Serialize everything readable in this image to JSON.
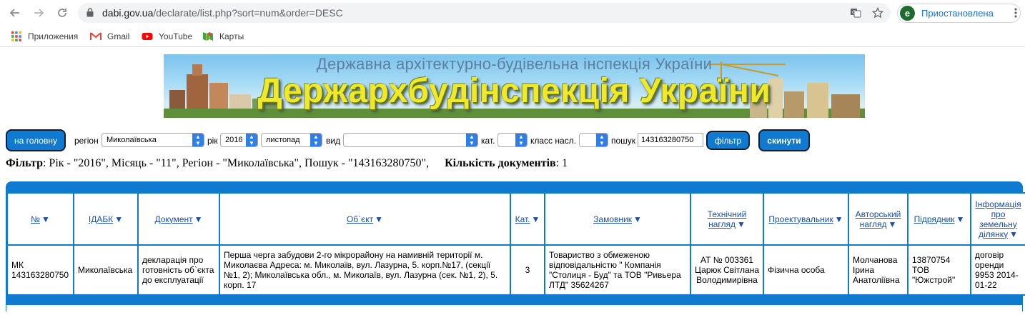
{
  "browser": {
    "url_host": "dabi.gov.ua",
    "url_path": "/declarate/list.php?sort=num&order=DESC",
    "profile_initial": "e",
    "profile_label": "Приостановлена",
    "bookmarks": [
      {
        "label": "Приложения",
        "icon": "apps-grid-icon"
      },
      {
        "label": "Gmail",
        "icon": "gmail-icon"
      },
      {
        "label": "YouTube",
        "icon": "youtube-icon"
      },
      {
        "label": "Карты",
        "icon": "maps-icon"
      }
    ]
  },
  "banner": {
    "subtitle": "Державна архітектурно-будівельна інспекція України",
    "title": "Держархбудінспекція України"
  },
  "filters": {
    "home_button": "на головну",
    "region_label": "регіон",
    "region_value": "Миколаївська",
    "year_label": "рік",
    "year_value": "2016",
    "month_value": "листопад",
    "type_label": "вид",
    "type_value": "",
    "cat_label": "кат.",
    "cat_value": "",
    "class_label": "класс насл.",
    "class_value": "",
    "search_label": "пошук",
    "search_value": "143163280750",
    "filter_button": "фільтр",
    "reset_button": "скинути"
  },
  "summary": {
    "filter_label": "Фільтр",
    "filter_text": ": Рік - \"2016\", Місяць - \"11\", Регіон - \"Миколаївська\", Пошук - \"143163280750\",",
    "count_label": "Кількість документів",
    "count_value": ": 1"
  },
  "table": {
    "headers": [
      "№",
      "ІДАБК",
      "Документ",
      "Об`єкт",
      "Кат.",
      "Замовник",
      "Технічний нагляд",
      "Проектувальник",
      "Авторський нагляд",
      "Підрядник",
      "Інформація про земельну ділянку"
    ],
    "rows": [
      [
        "МК 143163280750",
        "Миколаївська",
        "декларація про готовність об`єкта до експлуатації",
        "Перша черга забудови 2-го мікрорайону на намивній території м. Миколаєва Адреса: м. Миколаїв, вул. Лазурна, 5. корп.№17, (секції №1, 2); Миколаївська обл., м. Миколаїв, вул. Лазурна (сек. №1, 2), 5. корп. 17",
        "3",
        "Товариство з обмеженою відповідальністю \" Компанія \"Столиця - Буд\" та ТОВ \"Ривьера ЛТД\" 35624267",
        "АТ № 003361 Царюк Світлана Володимирівна",
        "Фізична особа",
        "Молчанова Ірина Анатоліївна",
        "13870754 ТОВ \"Южстрой\"",
        "договір оренди 9953 2014-01-22"
      ]
    ]
  },
  "colors": {
    "accent": "#0f7ad0",
    "link": "#1a4fa8",
    "select_arrow": "#2f7fe6",
    "banner_title": "#f2e82b"
  }
}
